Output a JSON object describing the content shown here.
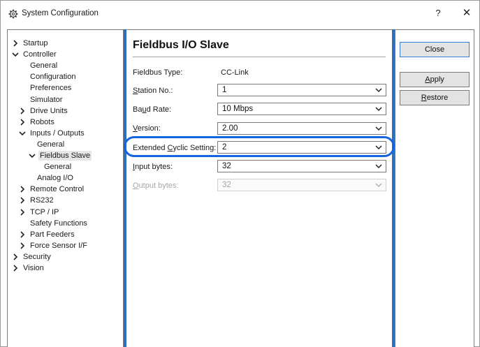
{
  "window": {
    "title": "System Configuration",
    "help_label": "?",
    "close_label": "✕"
  },
  "tree": {
    "items": [
      {
        "label": "Startup",
        "level": 0,
        "chevron": "right"
      },
      {
        "label": "Controller",
        "level": 0,
        "chevron": "down"
      },
      {
        "label": "General",
        "level": 2,
        "chevron": ""
      },
      {
        "label": "Configuration",
        "level": 2,
        "chevron": ""
      },
      {
        "label": "Preferences",
        "level": 2,
        "chevron": ""
      },
      {
        "label": "Simulator",
        "level": 2,
        "chevron": ""
      },
      {
        "label": "Drive Units",
        "level": 1,
        "chevron": "right"
      },
      {
        "label": "Robots",
        "level": 1,
        "chevron": "right"
      },
      {
        "label": "Inputs / Outputs",
        "level": 1,
        "chevron": "down"
      },
      {
        "label": "General",
        "level": 3,
        "chevron": ""
      },
      {
        "label": "Fieldbus Slave",
        "level": 2,
        "chevron": "down"
      },
      {
        "label": "General",
        "level": 4,
        "chevron": ""
      },
      {
        "label": "Analog I/O",
        "level": 3,
        "chevron": ""
      },
      {
        "label": "Remote Control",
        "level": 1,
        "chevron": "right"
      },
      {
        "label": "RS232",
        "level": 1,
        "chevron": "right"
      },
      {
        "label": "TCP / IP",
        "level": 1,
        "chevron": "right"
      },
      {
        "label": "Safety Functions",
        "level": 2,
        "chevron": ""
      },
      {
        "label": "Part Feeders",
        "level": 1,
        "chevron": "right"
      },
      {
        "label": "Force Sensor I/F",
        "level": 1,
        "chevron": "right"
      },
      {
        "label": "Security",
        "level": 0,
        "chevron": "right"
      },
      {
        "label": "Vision",
        "level": 0,
        "chevron": "right"
      }
    ],
    "selected_label": "Fieldbus Slave"
  },
  "main": {
    "title": "Fieldbus I/O Slave",
    "fields": {
      "fieldbus_type": {
        "label": "Fieldbus Type:",
        "value": "CC-Link"
      },
      "station_no": {
        "label_pre": "",
        "label_u": "S",
        "label_post": "tation No.:",
        "value": "1"
      },
      "baud_rate": {
        "label_pre": "Ba",
        "label_u": "u",
        "label_post": "d Rate:",
        "value": "10 Mbps"
      },
      "version": {
        "label_pre": "",
        "label_u": "V",
        "label_post": "ersion:",
        "value": "2.00"
      },
      "extended_cyclic": {
        "label_pre": "Extended ",
        "label_u": "C",
        "label_post": "yclic Setting:",
        "value": "2"
      },
      "input_bytes": {
        "label_pre": "",
        "label_u": "I",
        "label_post": "nput bytes:",
        "value": "32"
      },
      "output_bytes": {
        "label_pre": "",
        "label_u": "O",
        "label_post": "utput bytes:",
        "value": "32"
      }
    }
  },
  "buttons": {
    "close": {
      "label": "Close"
    },
    "apply": {
      "label_u": "A",
      "label_post": "pply"
    },
    "restore": {
      "label_u": "R",
      "label_post": "estore"
    }
  },
  "colors": {
    "accent_bar": "#2b6fbf",
    "highlight_ring": "#1565e0"
  },
  "icons": {
    "title": "gear-icon",
    "dropdown": "chevron-down-icon",
    "tree_collapsed": "chevron-right-icon",
    "tree_expanded": "chevron-down-icon"
  }
}
